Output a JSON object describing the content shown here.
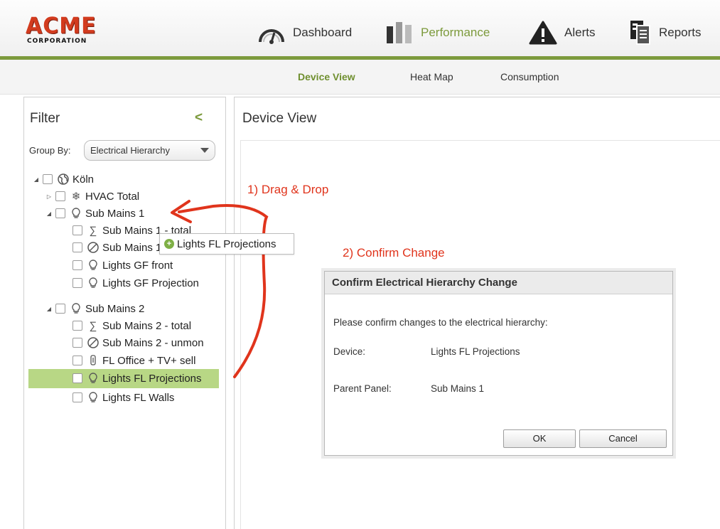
{
  "app": {
    "logo_text": "ACME",
    "logo_sub": "CORPORATION"
  },
  "nav": [
    {
      "label": "Dashboard",
      "icon": "gauge-icon"
    },
    {
      "label": "Performance",
      "icon": "bar-chart-icon",
      "active": true
    },
    {
      "label": "Alerts",
      "icon": "warning-icon"
    },
    {
      "label": "Reports",
      "icon": "report-icon"
    }
  ],
  "subnav": [
    {
      "label": "Device View",
      "active": true
    },
    {
      "label": "Heat Map"
    },
    {
      "label": "Consumption"
    }
  ],
  "filter": {
    "title": "Filter",
    "collapse_glyph": "<",
    "group_by_label": "Group By:",
    "group_by_value": "Electrical Hierarchy"
  },
  "tree": [
    {
      "label": "Köln",
      "icon": "globe-icon"
    },
    {
      "label": "HVAC Total",
      "icon": "snowflake-icon"
    },
    {
      "label": "Sub Mains 1",
      "icon": "bulb-icon"
    },
    {
      "label": "Sub Mains 1 - total",
      "icon": "sigma-icon"
    },
    {
      "label": "Sub Mains 1 - unmon",
      "icon": "block-icon"
    },
    {
      "label": "Lights GF front",
      "icon": "bulb-icon"
    },
    {
      "label": "Lights GF Projection",
      "icon": "bulb-icon"
    },
    {
      "label": "Sub Mains 2",
      "icon": "bulb-icon"
    },
    {
      "label": "Sub Mains 2 - total",
      "icon": "sigma-icon"
    },
    {
      "label": "Sub Mains 2 - unmon",
      "icon": "block-icon"
    },
    {
      "label": "FL Office + TV+ sell",
      "icon": "plug-icon"
    },
    {
      "label": "Lights FL Projections",
      "icon": "bulb-icon",
      "selected": true
    },
    {
      "label": "Lights FL Walls",
      "icon": "bulb-icon"
    }
  ],
  "drag_ghost": {
    "label": "Lights FL Projections",
    "icon": "add-icon"
  },
  "main": {
    "title": "Device View"
  },
  "annotations": {
    "step1": "1) Drag & Drop",
    "step2": "2) Confirm Change"
  },
  "dialog": {
    "title": "Confirm Electrical Hierarchy Change",
    "message": "Please confirm changes to the electrical hierarchy:",
    "device_label": "Device:",
    "device_value": "Lights FL Projections",
    "parent_label": "Parent Panel:",
    "parent_value": "Sub Mains 1",
    "ok_label": "OK",
    "cancel_label": "Cancel"
  },
  "colors": {
    "accent": "#7c9a3c",
    "annotation": "#e0341c",
    "selection": "#b8d785",
    "logo": "#d23b1e"
  }
}
